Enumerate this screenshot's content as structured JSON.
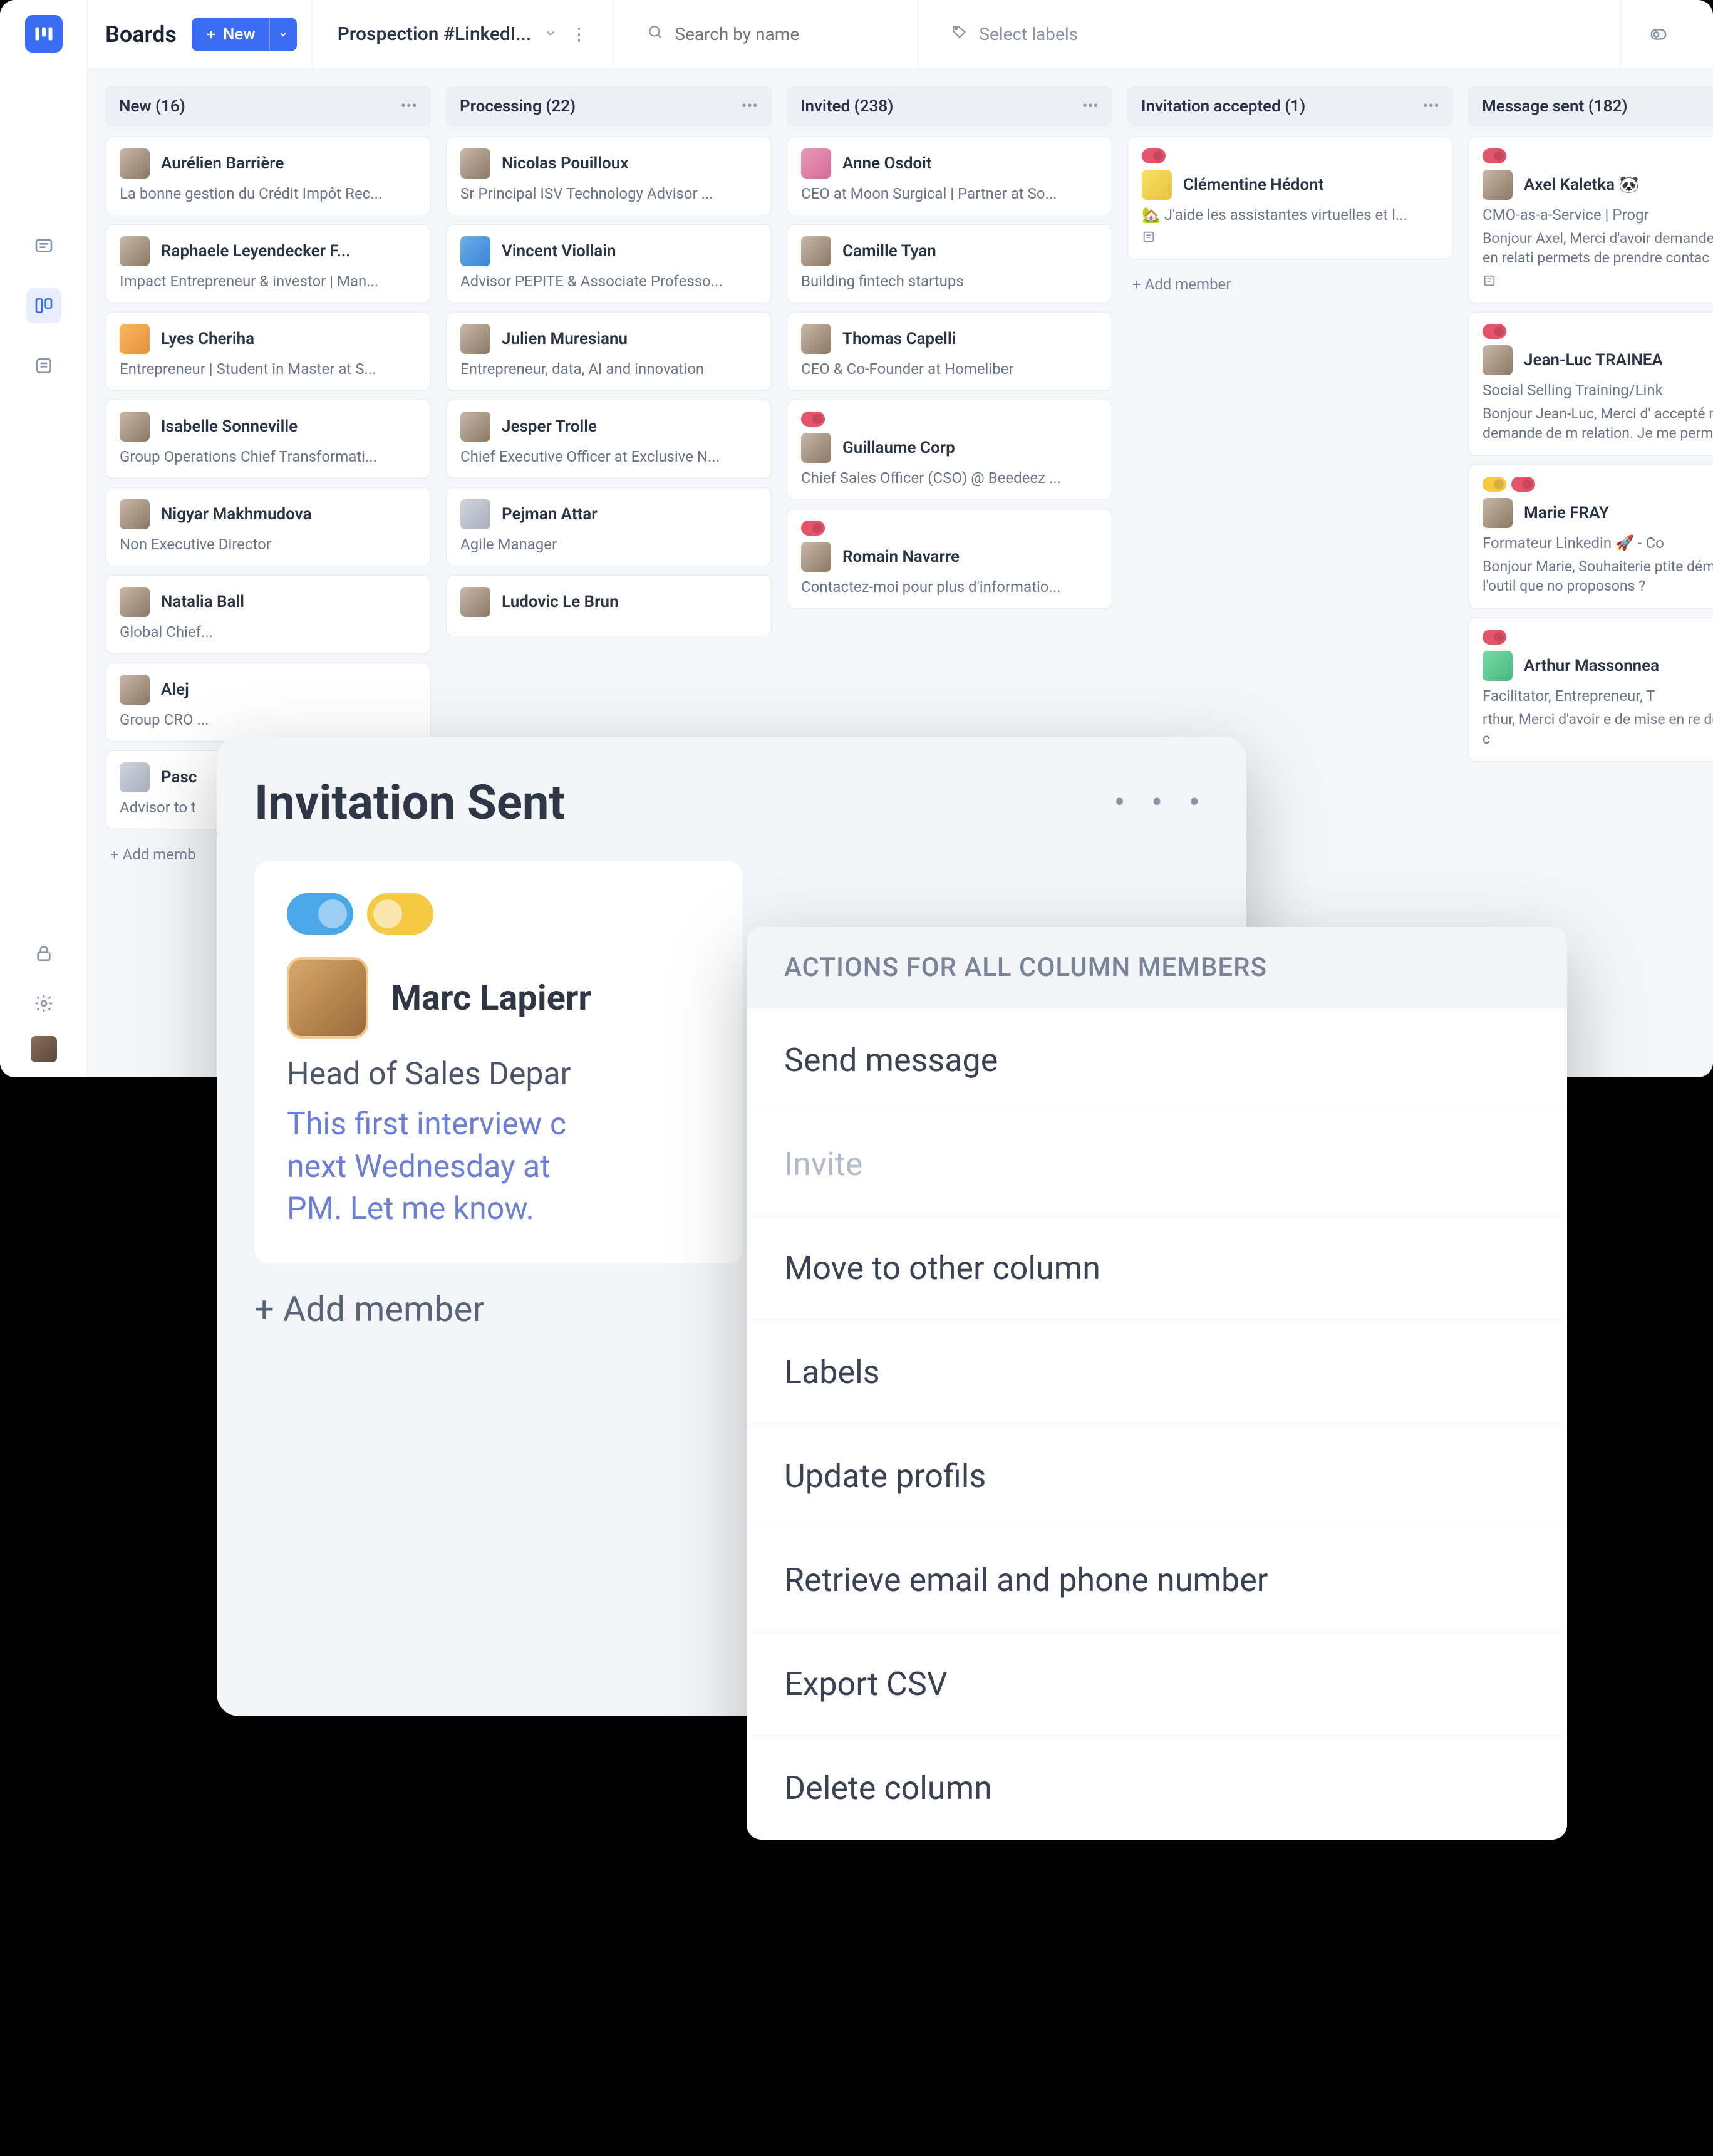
{
  "topbar": {
    "title": "Boards",
    "new_label": "New",
    "board_name": "Prospection #LinkedI...",
    "search_placeholder": "Search by name",
    "labels_placeholder": "Select labels"
  },
  "columns": [
    {
      "title": "New (16)",
      "cards": [
        {
          "name": "Aurélien Barrière",
          "sub": "La bonne gestion du Crédit Impôt Rec...",
          "avatar": ""
        },
        {
          "name": "Raphaele Leyendecker F...",
          "sub": "Impact Entrepreneur & investor | Man...",
          "avatar": ""
        },
        {
          "name": "Lyes Cheriha",
          "sub": "Entrepreneur | Student in Master at S...",
          "avatar": "orange"
        },
        {
          "name": "Isabelle Sonneville",
          "sub": "Group Operations Chief Transformati...",
          "avatar": ""
        },
        {
          "name": "Nigyar Makhmudova",
          "sub": "Non Executive Director",
          "avatar": ""
        },
        {
          "name": "Natalia Ball",
          "sub": "Global Chief...",
          "avatar": ""
        },
        {
          "name": "Alej",
          "sub": "Group CRO ...",
          "avatar": ""
        },
        {
          "name": "Pasc",
          "sub": "Advisor to t",
          "avatar": "grey"
        }
      ],
      "add_label": "+ Add memb"
    },
    {
      "title": "Processing (22)",
      "cards": [
        {
          "name": "Nicolas Pouilloux",
          "sub": "Sr Principal ISV Technology Advisor ...",
          "avatar": ""
        },
        {
          "name": "Vincent Viollain",
          "sub": "Advisor PEPITE & Associate Professo...",
          "avatar": "blue"
        },
        {
          "name": "Julien Muresianu",
          "sub": "Entrepreneur, data, AI and innovation",
          "avatar": ""
        },
        {
          "name": "Jesper Trolle",
          "sub": "Chief Executive Officer at Exclusive N...",
          "avatar": ""
        },
        {
          "name": "Pejman Attar",
          "sub": "Agile Manager",
          "avatar": "grey"
        },
        {
          "name": "Ludovic Le Brun",
          "sub": "",
          "avatar": ""
        }
      ]
    },
    {
      "title": "Invited (238)",
      "cards": [
        {
          "name": "Anne Osdoit",
          "sub": "CEO at Moon Surgical | Partner at So...",
          "avatar": "pink"
        },
        {
          "name": "Camille Tyan",
          "sub": "Building fintech startups",
          "avatar": ""
        },
        {
          "name": "Thomas Capelli",
          "sub": "CEO & Co-Founder at Homeliber",
          "avatar": ""
        },
        {
          "name": "Guillaume Corp",
          "sub": "Chief Sales Officer (CSO) @ Beedeez ...",
          "avatar": "",
          "badges": [
            "red"
          ]
        },
        {
          "name": "Romain Navarre",
          "sub": "Contactez-moi pour plus d'informatio...",
          "avatar": "",
          "badges": [
            "red"
          ]
        }
      ]
    },
    {
      "title": "Invitation accepted (1)",
      "cards": [
        {
          "name": "Clémentine Hédont",
          "sub": "🏡 J'aide les assistantes virtuelles et l...",
          "avatar": "yellow",
          "badges": [
            "red"
          ],
          "foot_icon": true
        }
      ],
      "add_label": "+ Add member"
    },
    {
      "title": "Message sent (182)",
      "cards": [
        {
          "name": "Axel Kaletka 🐼",
          "sub": "CMO-as-a-Service | Progr",
          "msg": "Bonjour Axel, Merci d'avoir\ndemande de mise en relati\npermets de prendre contac",
          "avatar": "",
          "badges": [
            "red"
          ],
          "foot_icon": true
        },
        {
          "name": "Jean-Luc TRAINEA",
          "sub": "Social Selling Training/Link",
          "msg": "Bonjour Jean-Luc, Merci d'\naccepté ma demande de m\nrelation. Je me permets de",
          "avatar": "",
          "badges": [
            "red"
          ]
        },
        {
          "name": "Marie FRAY",
          "sub": "Formateur Linkedin 🚀 - Co",
          "msg": "Bonjour Marie, Souhaiterie\nptite démo de l'outil que no\nproposons ?",
          "avatar": "",
          "badges": [
            "yellow",
            "red"
          ]
        },
        {
          "name": "Arthur Massonnea",
          "sub": "Facilitator, Entrepreneur, T",
          "msg": "rthur, Merci d'avoir\ne de mise en re\nde prendre c",
          "avatar": "green",
          "badges": [
            "red"
          ]
        }
      ]
    }
  ],
  "popout": {
    "title": "Invitation Sent",
    "card": {
      "name": "Marc Lapierr",
      "role": "Head of Sales Depar",
      "note": "This first interview c\nnext Wednesday at \nPM. Let me know."
    },
    "add_label": "+ Add member"
  },
  "actions_menu": {
    "header": "ACTIONS FOR ALL COLUMN MEMBERS",
    "items": [
      {
        "label": "Send message"
      },
      {
        "label": "Invite",
        "disabled": true
      },
      {
        "label": "Move to other column"
      },
      {
        "label": "Labels"
      },
      {
        "label": "Update profils"
      },
      {
        "label": "Retrieve email and phone number"
      },
      {
        "label": "Export CSV"
      },
      {
        "label": "Delete column"
      }
    ]
  }
}
